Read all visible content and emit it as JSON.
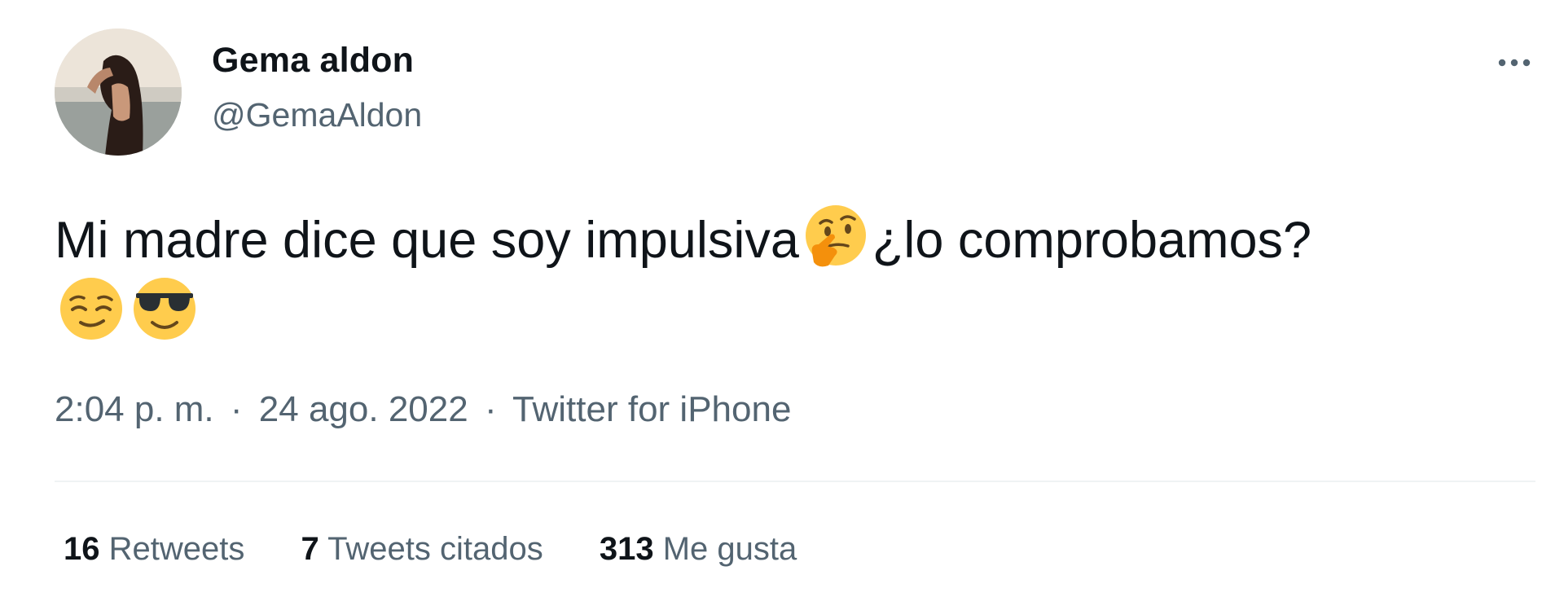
{
  "user": {
    "display_name": "Gema aldon",
    "handle": "@GemaAldon"
  },
  "tweet": {
    "text_part1": "Mi madre dice que soy impulsiva",
    "text_part2": "¿lo comprobamos?",
    "emojis": [
      "thinking-face",
      "relieved-face",
      "smiling-face-with-sunglasses"
    ]
  },
  "meta": {
    "time": "2:04 p. m.",
    "separator": "·",
    "date": "24 ago. 2022",
    "source": "Twitter for iPhone"
  },
  "stats": {
    "retweets_count": "16",
    "retweets_label": "Retweets",
    "quotes_count": "7",
    "quotes_label": "Tweets citados",
    "likes_count": "313",
    "likes_label": "Me gusta"
  },
  "colors": {
    "text": "#0f1419",
    "secondary": "#536471",
    "divider": "#eff3f4",
    "emoji_yellow": "#ffcc4d"
  }
}
